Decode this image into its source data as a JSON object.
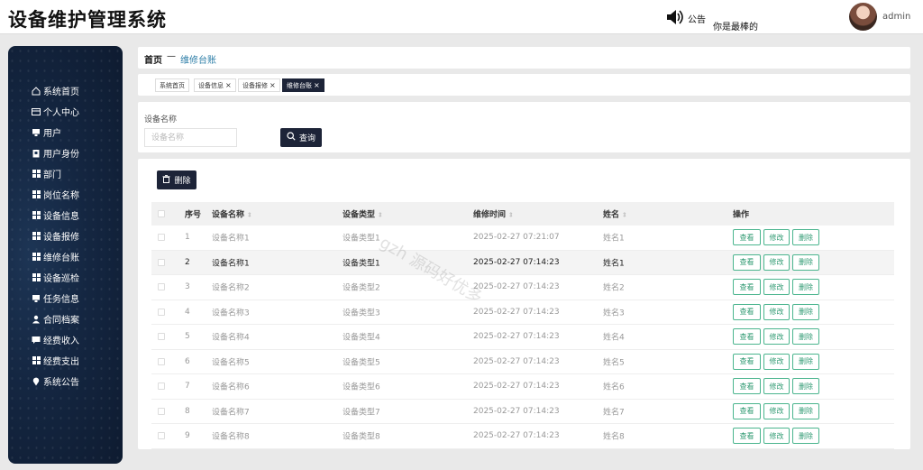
{
  "app": {
    "title": "设备维护管理系统"
  },
  "header": {
    "notice_label": "公告",
    "notice_text": "你是最棒的",
    "user_name": "admin"
  },
  "sidebar": {
    "items": [
      {
        "label": "系统首页",
        "icon": "home-icon"
      },
      {
        "label": "个人中心",
        "icon": "id-card-icon"
      },
      {
        "label": "用户",
        "icon": "monitor-icon"
      },
      {
        "label": "用户身份",
        "icon": "clipboard-icon"
      },
      {
        "label": "部门",
        "icon": "grid-icon"
      },
      {
        "label": "岗位名称",
        "icon": "grid-icon"
      },
      {
        "label": "设备信息",
        "icon": "grid-icon"
      },
      {
        "label": "设备报修",
        "icon": "grid-icon"
      },
      {
        "label": "维修台账",
        "icon": "grid-icon"
      },
      {
        "label": "设备巡检",
        "icon": "grid-icon"
      },
      {
        "label": "任务信息",
        "icon": "monitor-icon"
      },
      {
        "label": "合同档案",
        "icon": "person-icon"
      },
      {
        "label": "经费收入",
        "icon": "chat-icon"
      },
      {
        "label": "经费支出",
        "icon": "grid-icon"
      },
      {
        "label": "系统公告",
        "icon": "location-icon"
      }
    ]
  },
  "breadcrumb": {
    "home": "首页",
    "separator": "—",
    "current": "维修台账"
  },
  "tabs": [
    {
      "label": "系统首页",
      "closable": false,
      "active": false
    },
    {
      "label": "设备信息",
      "closable": true,
      "active": false
    },
    {
      "label": "设备报修",
      "closable": true,
      "active": false
    },
    {
      "label": "维修台账",
      "closable": true,
      "active": true
    }
  ],
  "search": {
    "label": "设备名称",
    "placeholder": "设备名称",
    "value": "",
    "button_label": "查询"
  },
  "toolbar": {
    "delete_label": "删除"
  },
  "table": {
    "headers": {
      "index": "序号",
      "name": "设备名称",
      "type": "设备类型",
      "time": "维修时间",
      "person": "姓名",
      "actions": "操作"
    },
    "action_labels": {
      "view": "查看",
      "edit": "修改",
      "delete": "删除"
    },
    "rows": [
      {
        "index": "1",
        "name": "设备名称1",
        "type": "设备类型1",
        "time": "2025-02-27 07:21:07",
        "person": "姓名1"
      },
      {
        "index": "2",
        "name": "设备名称1",
        "type": "设备类型1",
        "time": "2025-02-27 07:14:23",
        "person": "姓名1"
      },
      {
        "index": "3",
        "name": "设备名称2",
        "type": "设备类型2",
        "time": "2025-02-27 07:14:23",
        "person": "姓名2"
      },
      {
        "index": "4",
        "name": "设备名称3",
        "type": "设备类型3",
        "time": "2025-02-27 07:14:23",
        "person": "姓名3"
      },
      {
        "index": "5",
        "name": "设备名称4",
        "type": "设备类型4",
        "time": "2025-02-27 07:14:23",
        "person": "姓名4"
      },
      {
        "index": "6",
        "name": "设备名称5",
        "type": "设备类型5",
        "time": "2025-02-27 07:14:23",
        "person": "姓名5"
      },
      {
        "index": "7",
        "name": "设备名称6",
        "type": "设备类型6",
        "time": "2025-02-27 07:14:23",
        "person": "姓名6"
      },
      {
        "index": "8",
        "name": "设备名称7",
        "type": "设备类型7",
        "time": "2025-02-27 07:14:23",
        "person": "姓名7"
      },
      {
        "index": "9",
        "name": "设备名称8",
        "type": "设备类型8",
        "time": "2025-02-27 07:14:23",
        "person": "姓名8"
      }
    ]
  },
  "watermark": "gzh 源码好优多",
  "colors": {
    "primary_dark": "#1d2438",
    "accent_link": "#2f7fa8",
    "action_green": "#4bb58e"
  }
}
